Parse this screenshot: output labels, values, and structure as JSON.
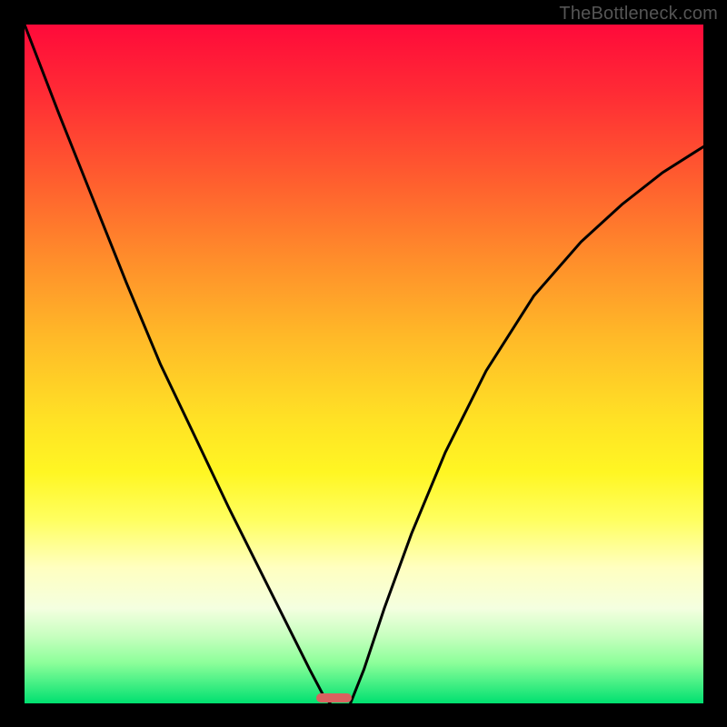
{
  "watermark": "TheBottleneck.com",
  "marker": {
    "x_frac": 0.43,
    "width_frac": 0.052,
    "height_frac": 0.013
  },
  "chart_data": {
    "type": "line",
    "title": "",
    "xlabel": "",
    "ylabel": "",
    "xlim": [
      0,
      1
    ],
    "ylim": [
      0,
      1
    ],
    "grid": false,
    "legend": false,
    "background": "gradient",
    "gradient_stops": [
      {
        "pos": 0.0,
        "color": "#ff0a3a"
      },
      {
        "pos": 0.25,
        "color": "#ff6e2e"
      },
      {
        "pos": 0.5,
        "color": "#ffd426"
      },
      {
        "pos": 0.7,
        "color": "#ffff58"
      },
      {
        "pos": 0.85,
        "color": "#f0ffd0"
      },
      {
        "pos": 1.0,
        "color": "#00e070"
      }
    ],
    "series": [
      {
        "name": "left-branch",
        "x": [
          0.0,
          0.05,
          0.1,
          0.15,
          0.2,
          0.25,
          0.3,
          0.35,
          0.4,
          0.42,
          0.44,
          0.45
        ],
        "y": [
          1.0,
          0.87,
          0.745,
          0.62,
          0.5,
          0.395,
          0.29,
          0.19,
          0.09,
          0.05,
          0.012,
          0.0
        ]
      },
      {
        "name": "right-branch",
        "x": [
          0.48,
          0.5,
          0.53,
          0.57,
          0.62,
          0.68,
          0.75,
          0.82,
          0.88,
          0.94,
          1.0
        ],
        "y": [
          0.0,
          0.05,
          0.14,
          0.25,
          0.37,
          0.49,
          0.6,
          0.68,
          0.735,
          0.782,
          0.82
        ]
      }
    ],
    "marker": {
      "x": 0.456,
      "y": 0.005,
      "w": 0.052
    }
  }
}
